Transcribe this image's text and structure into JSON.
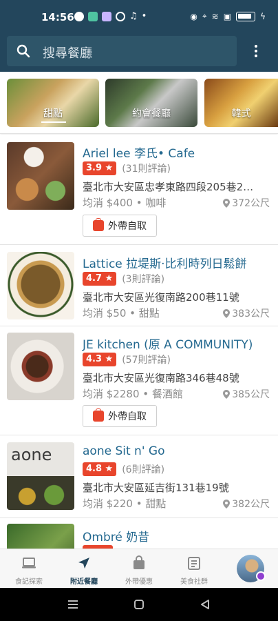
{
  "status_bar": {
    "time": "14:56"
  },
  "search": {
    "placeholder": "搜尋餐廳"
  },
  "categories": [
    {
      "label": "甜點"
    },
    {
      "label": "約會餐廳"
    },
    {
      "label": "韓式"
    }
  ],
  "restaurants": [
    {
      "name": "Ariel lee 李氏• Cafe",
      "rating": "3.9 ★",
      "reviews": "(31則評論)",
      "address": "臺北市大安區忠孝東路四段205巷2…",
      "meta": "均消 $400 • 咖啡",
      "distance": "372公尺",
      "takeout": "外帶自取"
    },
    {
      "name": "Lattice 拉堤斯·比利時列日鬆餅",
      "rating": "4.7 ★",
      "reviews": "(3則評論)",
      "address": "臺北市大安區光復南路200巷11號",
      "meta": "均消 $50 • 甜點",
      "distance": "383公尺"
    },
    {
      "name": "JE kitchen (原 A COMMUNITY)",
      "rating": "4.3 ★",
      "reviews": "(57則評論)",
      "address": "臺北市大安區光復南路346巷48號",
      "meta": "均消 $2280 • 餐酒館",
      "distance": "385公尺",
      "takeout": "外帶自取"
    },
    {
      "name": "aone Sit n' Go",
      "rating": "4.8 ★",
      "reviews": "(6則評論)",
      "address": "臺北市大安區延吉街131巷19號",
      "meta": "均消 $220 • 甜點",
      "distance": "382公尺",
      "thumb_text": "aone"
    },
    {
      "name": "Ombré 奶昔"
    }
  ],
  "bottom_nav": [
    {
      "label": "食記探索",
      "icon": "laptop-icon"
    },
    {
      "label": "附近餐廳",
      "icon": "navigation-arrow-icon"
    },
    {
      "label": "外帶優惠",
      "icon": "takeout-bag-icon"
    },
    {
      "label": "美食社群",
      "icon": "community-list-icon"
    }
  ],
  "colors": {
    "primary": "#23465c",
    "link": "#23688f",
    "badge": "#e8452c"
  }
}
